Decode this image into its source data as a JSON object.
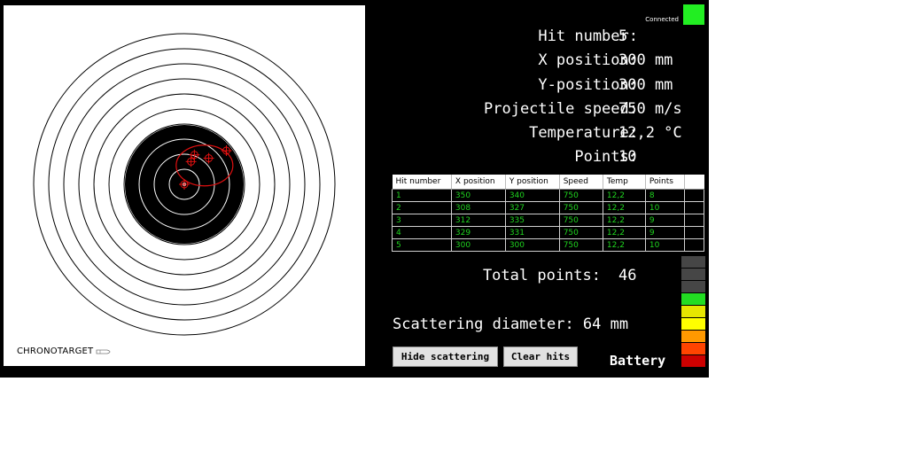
{
  "app": {
    "brand": "CHRONOTARGET"
  },
  "status": {
    "label": "Connected",
    "color": "#22ee22"
  },
  "info": {
    "hit_number_label": "Hit number:",
    "hit_number_value": "5",
    "x_label": "X position:",
    "x_value": "300 mm",
    "y_label": "Y-position:",
    "y_value": "300 mm",
    "speed_label": "Projectile speed:",
    "speed_value": "750 m/s",
    "temp_label": "Temperature:",
    "temp_value": "12,2 °C",
    "points_label": "Points:",
    "points_value": "10"
  },
  "table": {
    "headers": [
      "Hit number",
      "X position",
      "Y position",
      "Speed",
      "Temp",
      "Points",
      ""
    ],
    "rows": [
      [
        "1",
        "350",
        "340",
        "750",
        "12,2",
        "8",
        ""
      ],
      [
        "2",
        "308",
        "327",
        "750",
        "12,2",
        "10",
        ""
      ],
      [
        "3",
        "312",
        "335",
        "750",
        "12,2",
        "9",
        ""
      ],
      [
        "4",
        "329",
        "331",
        "750",
        "12,2",
        "9",
        ""
      ],
      [
        "5",
        "300",
        "300",
        "750",
        "12,2",
        "10",
        ""
      ]
    ]
  },
  "total": {
    "label": "Total points:",
    "value": "46"
  },
  "scattering": {
    "label": "Scattering diameter: 64 mm"
  },
  "buttons": {
    "hide_scattering": "Hide scattering",
    "clear_hits": "Clear hits"
  },
  "battery": {
    "label": "Battery",
    "segments": [
      "#464646",
      "#464646",
      "#464646",
      "#22dd22",
      "#e6e600",
      "#ffff00",
      "#ff9900",
      "#ff4400",
      "#cc0000"
    ]
  }
}
